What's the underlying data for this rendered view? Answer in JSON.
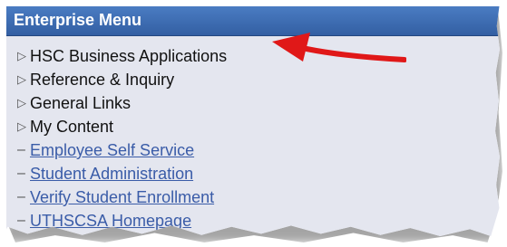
{
  "menu": {
    "title": "Enterprise Menu",
    "folders": [
      {
        "label": "HSC Business Applications",
        "icon": "triangle-right-icon"
      },
      {
        "label": "Reference & Inquiry",
        "icon": "triangle-right-icon"
      },
      {
        "label": "General Links",
        "icon": "triangle-right-icon"
      },
      {
        "label": "My Content",
        "icon": "triangle-right-icon"
      }
    ],
    "links": [
      {
        "label": "Employee Self Service"
      },
      {
        "label": "Student Administration"
      },
      {
        "label": "Verify Student Enrollment"
      },
      {
        "label": "UTHSCSA Homepage"
      }
    ]
  },
  "colors": {
    "header_bg": "#3b6bb0",
    "menu_bg": "#e4e6ef",
    "link": "#3a5ca8",
    "annotation_arrow": "#e01818"
  }
}
